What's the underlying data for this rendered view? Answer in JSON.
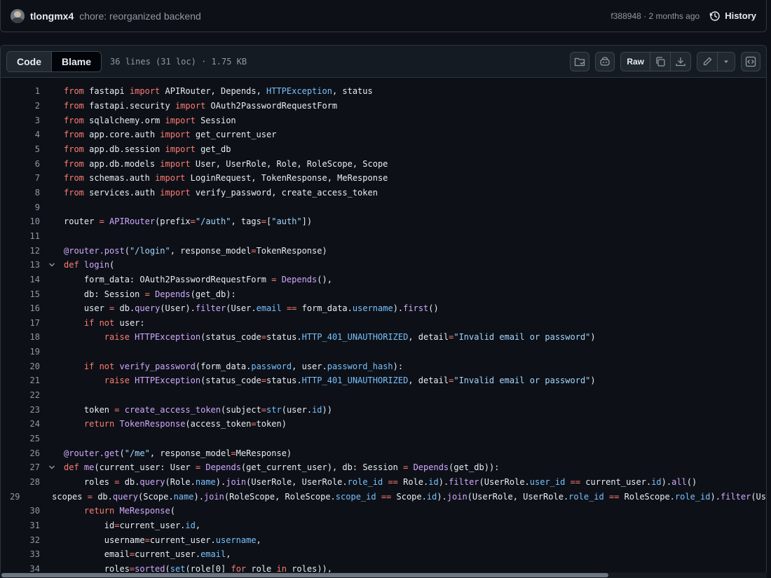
{
  "commit": {
    "author": "tlongmx4",
    "message": "chore: reorganized backend",
    "sha": "f388948",
    "age": "2 months ago",
    "history_label": "History"
  },
  "file": {
    "tabs": [
      "Code",
      "Blame"
    ],
    "meta": "36 lines (31 loc) · 1.75 KB",
    "raw_label": "Raw"
  },
  "code_lines": [
    {
      "n": "1",
      "fold": false,
      "tokens": [
        [
          "k",
          "from"
        ],
        [
          "t",
          " fastapi "
        ],
        [
          "k",
          "import"
        ],
        [
          "t",
          " APIRouter, Depends, "
        ],
        [
          "c",
          "HTTPException"
        ],
        [
          "t",
          ", status"
        ]
      ]
    },
    {
      "n": "2",
      "fold": false,
      "tokens": [
        [
          "k",
          "from"
        ],
        [
          "t",
          " fastapi.security "
        ],
        [
          "k",
          "import"
        ],
        [
          "t",
          " OAuth2PasswordRequestForm"
        ]
      ]
    },
    {
      "n": "3",
      "fold": false,
      "tokens": [
        [
          "k",
          "from"
        ],
        [
          "t",
          " sqlalchemy.orm "
        ],
        [
          "k",
          "import"
        ],
        [
          "t",
          " Session"
        ]
      ]
    },
    {
      "n": "4",
      "fold": false,
      "tokens": [
        [
          "k",
          "from"
        ],
        [
          "t",
          " app.core.auth "
        ],
        [
          "k",
          "import"
        ],
        [
          "t",
          " get_current_user"
        ]
      ]
    },
    {
      "n": "5",
      "fold": false,
      "tokens": [
        [
          "k",
          "from"
        ],
        [
          "t",
          " app.db.session "
        ],
        [
          "k",
          "import"
        ],
        [
          "t",
          " get_db"
        ]
      ]
    },
    {
      "n": "6",
      "fold": false,
      "tokens": [
        [
          "k",
          "from"
        ],
        [
          "t",
          " app.db.models "
        ],
        [
          "k",
          "import"
        ],
        [
          "t",
          " User, UserRole, Role, RoleScope, Scope"
        ]
      ]
    },
    {
      "n": "7",
      "fold": false,
      "tokens": [
        [
          "k",
          "from"
        ],
        [
          "t",
          " schemas.auth "
        ],
        [
          "k",
          "import"
        ],
        [
          "t",
          " LoginRequest, TokenResponse, MeResponse"
        ]
      ]
    },
    {
      "n": "8",
      "fold": false,
      "tokens": [
        [
          "k",
          "from"
        ],
        [
          "t",
          " services.auth "
        ],
        [
          "k",
          "import"
        ],
        [
          "t",
          " verify_password, create_access_token"
        ]
      ]
    },
    {
      "n": "9",
      "fold": false,
      "tokens": []
    },
    {
      "n": "10",
      "fold": false,
      "tokens": [
        [
          "t",
          "router "
        ],
        [
          "k",
          "="
        ],
        [
          "t",
          " "
        ],
        [
          "f",
          "APIRouter"
        ],
        [
          "t",
          "(prefix"
        ],
        [
          "k",
          "="
        ],
        [
          "s",
          "\"/auth\""
        ],
        [
          "t",
          ", tags"
        ],
        [
          "k",
          "="
        ],
        [
          "t",
          "["
        ],
        [
          "s",
          "\"auth\""
        ],
        [
          "t",
          "])"
        ]
      ]
    },
    {
      "n": "11",
      "fold": false,
      "tokens": []
    },
    {
      "n": "12",
      "fold": false,
      "tokens": [
        [
          "f",
          "@router.post"
        ],
        [
          "t",
          "("
        ],
        [
          "s",
          "\"/login\""
        ],
        [
          "t",
          ", response_model"
        ],
        [
          "k",
          "="
        ],
        [
          "t",
          "TokenResponse)"
        ]
      ]
    },
    {
      "n": "13",
      "fold": true,
      "tokens": [
        [
          "k",
          "def"
        ],
        [
          "t",
          " "
        ],
        [
          "f",
          "login"
        ],
        [
          "t",
          "("
        ]
      ]
    },
    {
      "n": "14",
      "fold": false,
      "tokens": [
        [
          "t",
          "    form_data: OAuth2PasswordRequestForm "
        ],
        [
          "k",
          "="
        ],
        [
          "t",
          " "
        ],
        [
          "f",
          "Depends"
        ],
        [
          "t",
          "(),"
        ]
      ]
    },
    {
      "n": "15",
      "fold": false,
      "tokens": [
        [
          "t",
          "    db: Session "
        ],
        [
          "k",
          "="
        ],
        [
          "t",
          " "
        ],
        [
          "f",
          "Depends"
        ],
        [
          "t",
          "(get_db):"
        ]
      ]
    },
    {
      "n": "16",
      "fold": false,
      "tokens": [
        [
          "t",
          "    user "
        ],
        [
          "k",
          "="
        ],
        [
          "t",
          " db."
        ],
        [
          "f",
          "query"
        ],
        [
          "t",
          "(User)."
        ],
        [
          "f",
          "filter"
        ],
        [
          "t",
          "(User."
        ],
        [
          "c",
          "email"
        ],
        [
          "t",
          " "
        ],
        [
          "k",
          "=="
        ],
        [
          "t",
          " form_data."
        ],
        [
          "c",
          "username"
        ],
        [
          "t",
          ")."
        ],
        [
          "f",
          "first"
        ],
        [
          "t",
          "()"
        ]
      ]
    },
    {
      "n": "17",
      "fold": false,
      "tokens": [
        [
          "t",
          "    "
        ],
        [
          "k",
          "if not"
        ],
        [
          "t",
          " user:"
        ]
      ]
    },
    {
      "n": "18",
      "fold": false,
      "tokens": [
        [
          "t",
          "        "
        ],
        [
          "k",
          "raise"
        ],
        [
          "t",
          " "
        ],
        [
          "f",
          "HTTPException"
        ],
        [
          "t",
          "(status_code"
        ],
        [
          "k",
          "="
        ],
        [
          "t",
          "status."
        ],
        [
          "c",
          "HTTP_401_UNAUTHORIZED"
        ],
        [
          "t",
          ", detail"
        ],
        [
          "k",
          "="
        ],
        [
          "s",
          "\"Invalid email or password\""
        ],
        [
          "t",
          ")"
        ]
      ]
    },
    {
      "n": "19",
      "fold": false,
      "tokens": []
    },
    {
      "n": "20",
      "fold": false,
      "tokens": [
        [
          "t",
          "    "
        ],
        [
          "k",
          "if not"
        ],
        [
          "t",
          " "
        ],
        [
          "f",
          "verify_password"
        ],
        [
          "t",
          "(form_data."
        ],
        [
          "c",
          "password"
        ],
        [
          "t",
          ", user."
        ],
        [
          "c",
          "password_hash"
        ],
        [
          "t",
          "):"
        ]
      ]
    },
    {
      "n": "21",
      "fold": false,
      "tokens": [
        [
          "t",
          "        "
        ],
        [
          "k",
          "raise"
        ],
        [
          "t",
          " "
        ],
        [
          "f",
          "HTTPException"
        ],
        [
          "t",
          "(status_code"
        ],
        [
          "k",
          "="
        ],
        [
          "t",
          "status."
        ],
        [
          "c",
          "HTTP_401_UNAUTHORIZED"
        ],
        [
          "t",
          ", detail"
        ],
        [
          "k",
          "="
        ],
        [
          "s",
          "\"Invalid email or password\""
        ],
        [
          "t",
          ")"
        ]
      ]
    },
    {
      "n": "22",
      "fold": false,
      "tokens": []
    },
    {
      "n": "23",
      "fold": false,
      "tokens": [
        [
          "t",
          "    token "
        ],
        [
          "k",
          "="
        ],
        [
          "t",
          " "
        ],
        [
          "f",
          "create_access_token"
        ],
        [
          "t",
          "(subject"
        ],
        [
          "k",
          "="
        ],
        [
          "c",
          "str"
        ],
        [
          "t",
          "(user."
        ],
        [
          "c",
          "id"
        ],
        [
          "t",
          "))"
        ]
      ]
    },
    {
      "n": "24",
      "fold": false,
      "tokens": [
        [
          "t",
          "    "
        ],
        [
          "k",
          "return"
        ],
        [
          "t",
          " "
        ],
        [
          "f",
          "TokenResponse"
        ],
        [
          "t",
          "(access_token"
        ],
        [
          "k",
          "="
        ],
        [
          "t",
          "token)"
        ]
      ]
    },
    {
      "n": "25",
      "fold": false,
      "tokens": []
    },
    {
      "n": "26",
      "fold": false,
      "tokens": [
        [
          "f",
          "@router.get"
        ],
        [
          "t",
          "("
        ],
        [
          "s",
          "\"/me\""
        ],
        [
          "t",
          ", response_model"
        ],
        [
          "k",
          "="
        ],
        [
          "t",
          "MeResponse)"
        ]
      ]
    },
    {
      "n": "27",
      "fold": true,
      "tokens": [
        [
          "k",
          "def"
        ],
        [
          "t",
          " "
        ],
        [
          "f",
          "me"
        ],
        [
          "t",
          "(current_user: User "
        ],
        [
          "k",
          "="
        ],
        [
          "t",
          " "
        ],
        [
          "f",
          "Depends"
        ],
        [
          "t",
          "(get_current_user), db: Session "
        ],
        [
          "k",
          "="
        ],
        [
          "t",
          " "
        ],
        [
          "f",
          "Depends"
        ],
        [
          "t",
          "(get_db)):"
        ]
      ]
    },
    {
      "n": "28",
      "fold": false,
      "tokens": [
        [
          "t",
          "    roles "
        ],
        [
          "k",
          "="
        ],
        [
          "t",
          " db."
        ],
        [
          "f",
          "query"
        ],
        [
          "t",
          "(Role."
        ],
        [
          "c",
          "name"
        ],
        [
          "t",
          ")."
        ],
        [
          "f",
          "join"
        ],
        [
          "t",
          "(UserRole, UserRole."
        ],
        [
          "c",
          "role_id"
        ],
        [
          "t",
          " "
        ],
        [
          "k",
          "=="
        ],
        [
          "t",
          " Role."
        ],
        [
          "c",
          "id"
        ],
        [
          "t",
          ")."
        ],
        [
          "f",
          "filter"
        ],
        [
          "t",
          "(UserRole."
        ],
        [
          "c",
          "user_id"
        ],
        [
          "t",
          " "
        ],
        [
          "k",
          "=="
        ],
        [
          "t",
          " current_user."
        ],
        [
          "c",
          "id"
        ],
        [
          "t",
          ")."
        ],
        [
          "f",
          "all"
        ],
        [
          "t",
          "()"
        ]
      ]
    },
    {
      "n": "29",
      "fold": false,
      "tokens": [
        [
          "t",
          "    scopes "
        ],
        [
          "k",
          "="
        ],
        [
          "t",
          " db."
        ],
        [
          "f",
          "query"
        ],
        [
          "t",
          "(Scope."
        ],
        [
          "c",
          "name"
        ],
        [
          "t",
          ")."
        ],
        [
          "f",
          "join"
        ],
        [
          "t",
          "(RoleScope, RoleScope."
        ],
        [
          "c",
          "scope_id"
        ],
        [
          "t",
          " "
        ],
        [
          "k",
          "=="
        ],
        [
          "t",
          " Scope."
        ],
        [
          "c",
          "id"
        ],
        [
          "t",
          ")."
        ],
        [
          "f",
          "join"
        ],
        [
          "t",
          "(UserRole, UserRole."
        ],
        [
          "c",
          "role_id"
        ],
        [
          "t",
          " "
        ],
        [
          "k",
          "=="
        ],
        [
          "t",
          " RoleScope."
        ],
        [
          "c",
          "role_id"
        ],
        [
          "t",
          ")."
        ],
        [
          "f",
          "filter"
        ],
        [
          "t",
          "(Us"
        ]
      ]
    },
    {
      "n": "30",
      "fold": false,
      "tokens": [
        [
          "t",
          "    "
        ],
        [
          "k",
          "return"
        ],
        [
          "t",
          " "
        ],
        [
          "f",
          "MeResponse"
        ],
        [
          "t",
          "("
        ]
      ]
    },
    {
      "n": "31",
      "fold": false,
      "tokens": [
        [
          "t",
          "        id"
        ],
        [
          "k",
          "="
        ],
        [
          "t",
          "current_user."
        ],
        [
          "c",
          "id"
        ],
        [
          "t",
          ","
        ]
      ]
    },
    {
      "n": "32",
      "fold": false,
      "tokens": [
        [
          "t",
          "        username"
        ],
        [
          "k",
          "="
        ],
        [
          "t",
          "current_user."
        ],
        [
          "c",
          "username"
        ],
        [
          "t",
          ","
        ]
      ]
    },
    {
      "n": "33",
      "fold": false,
      "tokens": [
        [
          "t",
          "        email"
        ],
        [
          "k",
          "="
        ],
        [
          "t",
          "current_user."
        ],
        [
          "c",
          "email"
        ],
        [
          "t",
          ","
        ]
      ]
    },
    {
      "n": "34",
      "fold": false,
      "tokens": [
        [
          "t",
          "        roles"
        ],
        [
          "k",
          "="
        ],
        [
          "f",
          "sorted"
        ],
        [
          "t",
          "("
        ],
        [
          "c",
          "set"
        ],
        [
          "t",
          "(role[0] "
        ],
        [
          "k",
          "for"
        ],
        [
          "t",
          " role "
        ],
        [
          "k",
          "in"
        ],
        [
          "t",
          " roles)),"
        ]
      ]
    }
  ]
}
